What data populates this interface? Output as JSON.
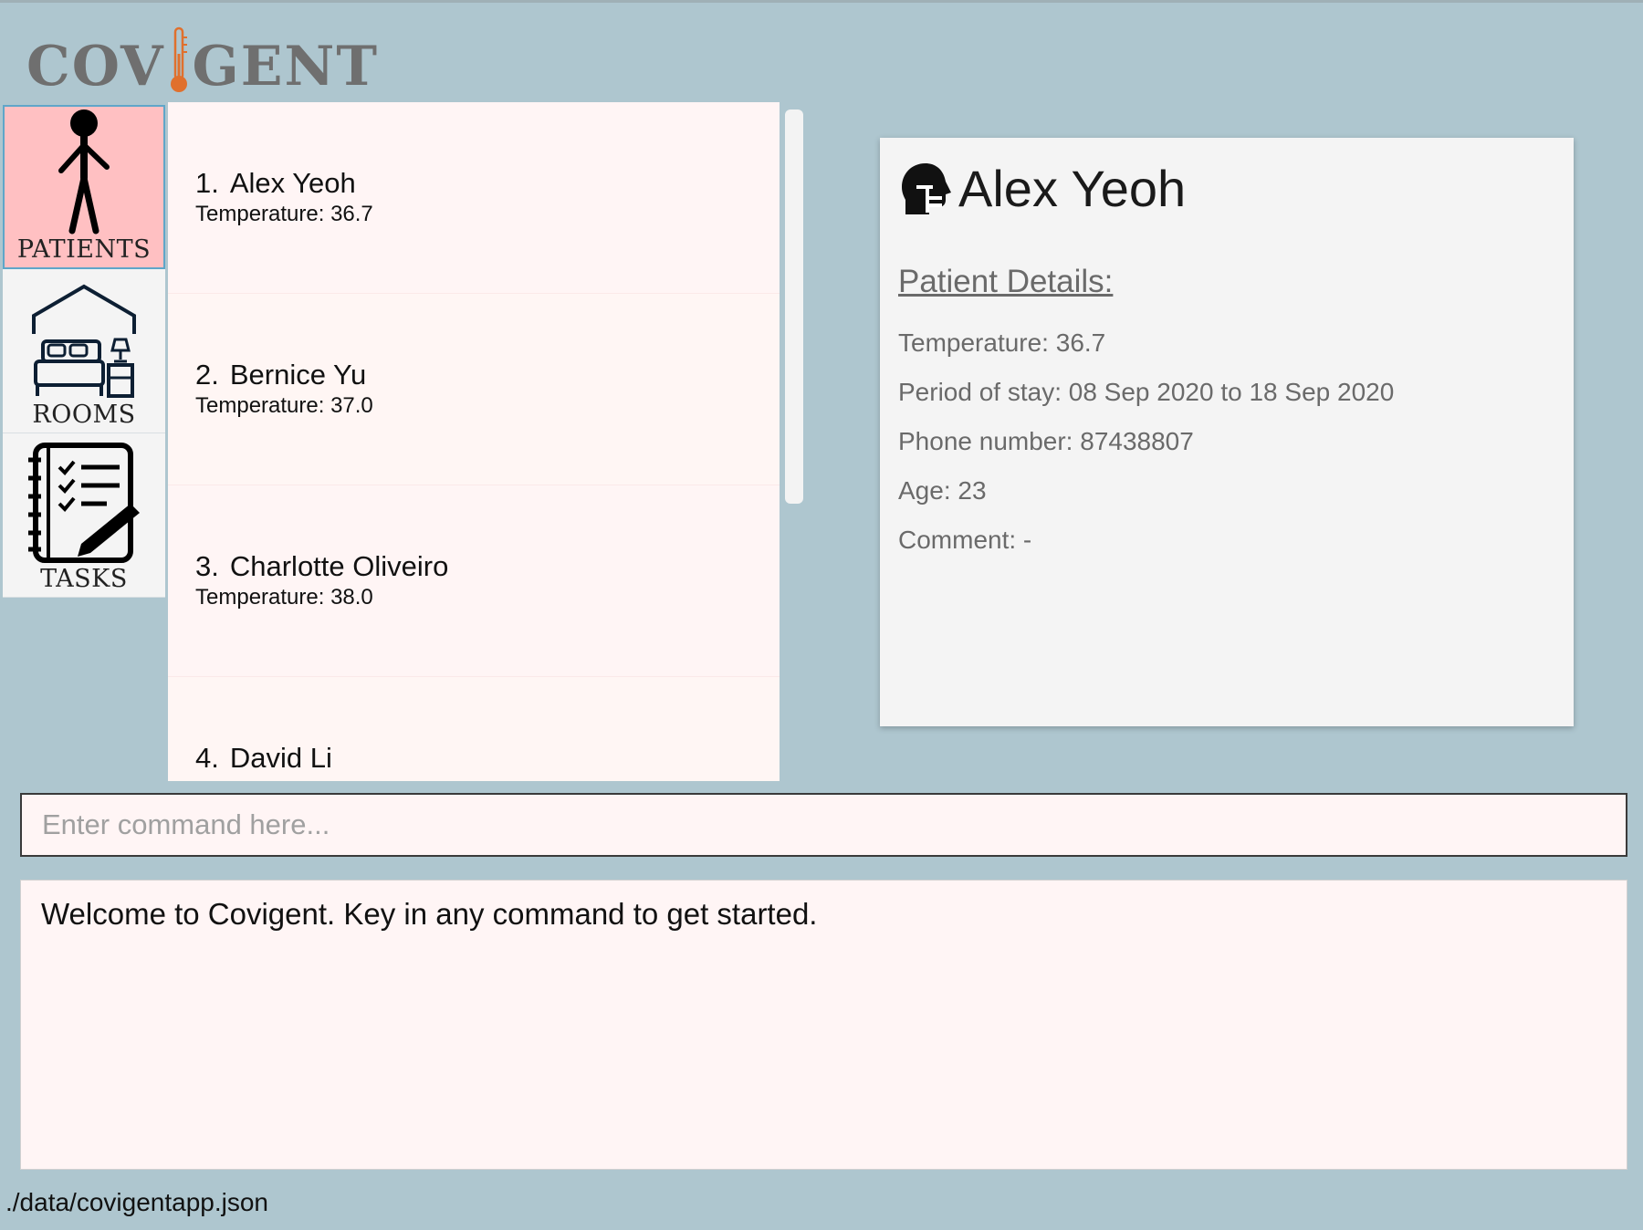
{
  "app": {
    "logo_left": "COV",
    "logo_right": "GENT",
    "thermometer_color": "#e0702d"
  },
  "sidebar": {
    "items": [
      {
        "label": "PATIENTS",
        "icon": "person-icon",
        "active": true
      },
      {
        "label": "ROOMS",
        "icon": "bed-room-icon",
        "active": false
      },
      {
        "label": "TASKS",
        "icon": "checklist-icon",
        "active": false
      }
    ]
  },
  "patients": [
    {
      "index": "1.",
      "name": "Alex Yeoh",
      "temperature": "Temperature: 36.7"
    },
    {
      "index": "2.",
      "name": "Bernice Yu",
      "temperature": "Temperature: 37.0"
    },
    {
      "index": "3.",
      "name": "Charlotte Oliveiro",
      "temperature": "Temperature: 38.0"
    },
    {
      "index": "4.",
      "name": "David Li",
      "temperature": ""
    }
  ],
  "detail": {
    "icon": "patient-head-icon",
    "name": "Alex Yeoh",
    "section_title": "Patient Details:",
    "fields": [
      "Temperature: 36.7",
      "Period of stay: 08 Sep 2020 to 18 Sep 2020",
      "Phone number: 87438807",
      "Age: 23",
      "Comment: -"
    ]
  },
  "command": {
    "placeholder": "Enter command here...",
    "value": ""
  },
  "result": {
    "text": "Welcome to Covigent. Key in any command to get started."
  },
  "status": {
    "path": "./data/covigentapp.json"
  },
  "colors": {
    "background": "#aec6cf",
    "panel": "#fff5f5",
    "active_nav": "#ffc0c2",
    "detail_card": "#f4f4f4"
  }
}
